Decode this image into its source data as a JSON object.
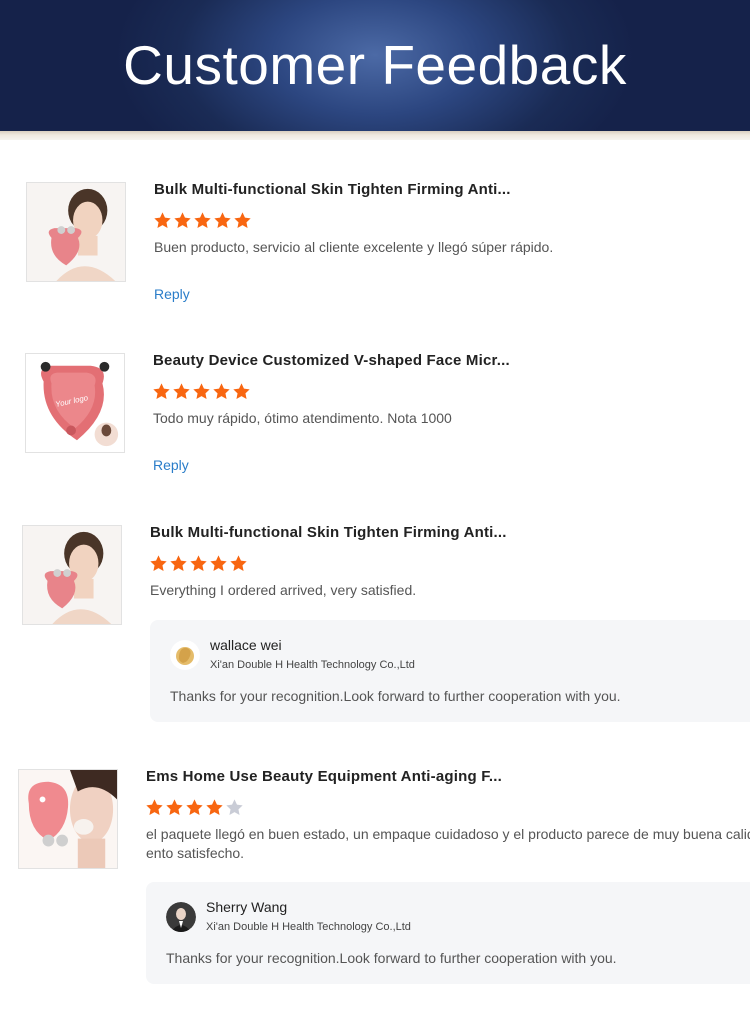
{
  "header": {
    "title": "Customer Feedback"
  },
  "colors": {
    "star_filled": "#f86611",
    "star_empty": "#c9ccd6",
    "link": "#2a7dc9",
    "banner": "#1a2b55"
  },
  "reviews": [
    {
      "product_title": "Bulk Multi-functional Skin Tighten Firming Anti...",
      "rating": 5,
      "comment": "Buen producto, servicio al cliente excelente y llegó súper rápido.",
      "reply_label": "Reply"
    },
    {
      "product_title": "Beauty Device Customized V-shaped Face Micr...",
      "rating": 5,
      "comment": "Todo muy rápido, ótimo atendimento. Nota 1000",
      "reply_label": "Reply",
      "thumb_text": "Your logo"
    },
    {
      "product_title": "Bulk Multi-functional Skin Tighten Firming Anti...",
      "rating": 5,
      "comment": "Everything I ordered arrived, very satisfied.",
      "reply": {
        "name": "wallace wei",
        "company": "Xi'an Double H Health Technology Co.,Ltd",
        "text": "Thanks for your recognition.Look forward to further cooperation with you."
      }
    },
    {
      "product_title": "Ems Home Use Beauty Equipment Anti-aging F...",
      "rating": 4,
      "comment_line1": "el paquete llegó en buen estado, un empaque cuidadoso y el producto parece de muy buena calidad",
      "comment_line2": "ento satisfecho.",
      "reply": {
        "name": "Sherry Wang",
        "company": "Xi'an Double H Health Technology Co.,Ltd",
        "text": "Thanks for your recognition.Look forward to further cooperation with you."
      }
    }
  ]
}
